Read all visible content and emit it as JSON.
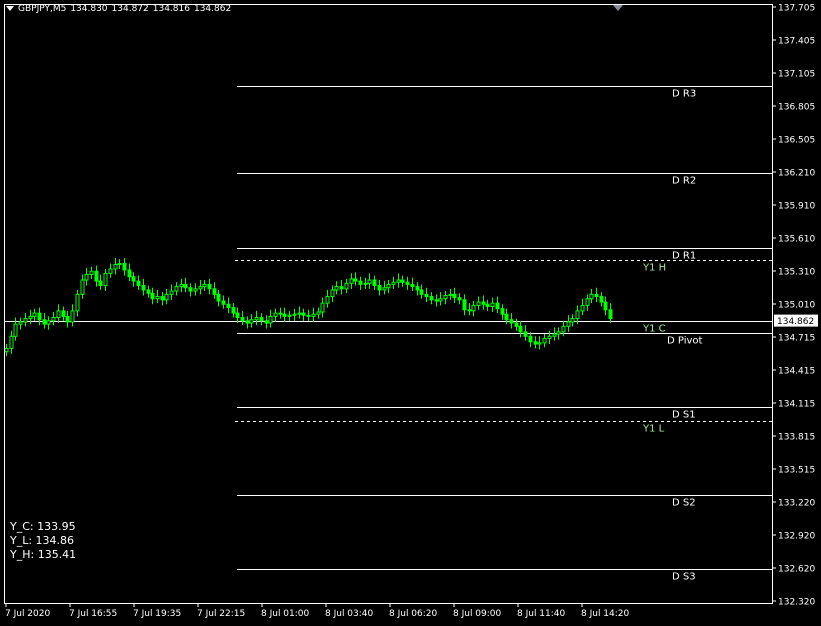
{
  "header": {
    "symbol_tf": "GBPJPY,M5",
    "open": "134.830",
    "high": "134.872",
    "low": "134.816",
    "close": "134.862"
  },
  "price_label": "134.862",
  "info": {
    "y_c": "Y_C: 133.95",
    "y_l": "Y_L: 134.86",
    "y_h": "Y_H: 135.41"
  },
  "colors": {
    "background": "#000000",
    "frame": "#ffffff",
    "candle": "#00ff00",
    "pivot_line": "#ffffff",
    "yearly_text": "#a0e8a0"
  },
  "chart_data": {
    "type": "candlestick",
    "symbol": "GBPJPY",
    "timeframe": "M5",
    "ylim": [
      132.32,
      137.705
    ],
    "y_ticks": [
      "137.705",
      "137.405",
      "137.105",
      "136.805",
      "136.505",
      "136.210",
      "135.910",
      "135.610",
      "135.310",
      "135.010",
      "134.715",
      "134.415",
      "134.115",
      "133.815",
      "133.515",
      "133.220",
      "132.920",
      "132.620",
      "132.320"
    ],
    "x_ticks": [
      "7 Jul 2020",
      "7 Jul 16:55",
      "7 Jul 19:35",
      "7 Jul 22:15",
      "8 Jul 01:00",
      "8 Jul 03:40",
      "8 Jul 06:20",
      "8 Jul 09:00",
      "8 Jul 11:40",
      "8 Jul 14:20"
    ],
    "current_price": 134.862,
    "levels": [
      {
        "label": "D R3",
        "value": 136.99,
        "style": "solid"
      },
      {
        "label": "D R2",
        "value": 136.2,
        "style": "solid"
      },
      {
        "label": "D R1",
        "value": 135.52,
        "style": "solid"
      },
      {
        "label": "Y1 H",
        "value": 135.41,
        "style": "dashed"
      },
      {
        "label": "Y1 C",
        "value": 134.86,
        "style": "solid"
      },
      {
        "label": "D Pivot",
        "value": 134.75,
        "style": "solid"
      },
      {
        "label": "D S1",
        "value": 134.08,
        "style": "solid"
      },
      {
        "label": "Y1 L",
        "value": 133.95,
        "style": "dashed"
      },
      {
        "label": "D S2",
        "value": 133.28,
        "style": "solid"
      },
      {
        "label": "D S3",
        "value": 132.61,
        "style": "solid"
      }
    ],
    "close_path": [
      134.61,
      134.72,
      134.83,
      134.85,
      134.88,
      134.9,
      134.93,
      134.87,
      134.83,
      134.86,
      134.89,
      134.95,
      134.9,
      134.85,
      134.95,
      135.1,
      135.23,
      135.28,
      135.31,
      135.22,
      135.18,
      135.29,
      135.33,
      135.37,
      135.38,
      135.32,
      135.26,
      135.22,
      135.18,
      135.14,
      135.11,
      135.06,
      135.08,
      135.05,
      135.1,
      135.13,
      135.17,
      135.19,
      135.16,
      135.13,
      135.15,
      135.17,
      135.19,
      135.15,
      135.1,
      135.04,
      135.01,
      134.98,
      134.93,
      134.89,
      134.86,
      134.84,
      134.87,
      134.89,
      134.86,
      134.84,
      134.9,
      134.93,
      134.92,
      134.9,
      134.91,
      134.92,
      134.93,
      134.91,
      134.9,
      134.92,
      134.94,
      135.02,
      135.08,
      135.14,
      135.17,
      135.15,
      135.2,
      135.24,
      135.22,
      135.19,
      135.2,
      135.23,
      135.18,
      135.14,
      135.16,
      135.19,
      135.21,
      135.23,
      135.21,
      135.19,
      135.17,
      135.14,
      135.1,
      135.08,
      135.05,
      135.04,
      135.06,
      135.09,
      135.1,
      135.07,
      135.05,
      134.96,
      134.95,
      135.0,
      135.03,
      135.01,
      134.99,
      135.02,
      134.97,
      134.92,
      134.87,
      134.84,
      134.81,
      134.76,
      134.72,
      134.67,
      134.65,
      134.66,
      134.7,
      134.72,
      134.74,
      134.76,
      134.81,
      134.85,
      134.88,
      134.95,
      135.0,
      135.06,
      135.1,
      135.08,
      135.03,
      134.96,
      134.88
    ]
  }
}
